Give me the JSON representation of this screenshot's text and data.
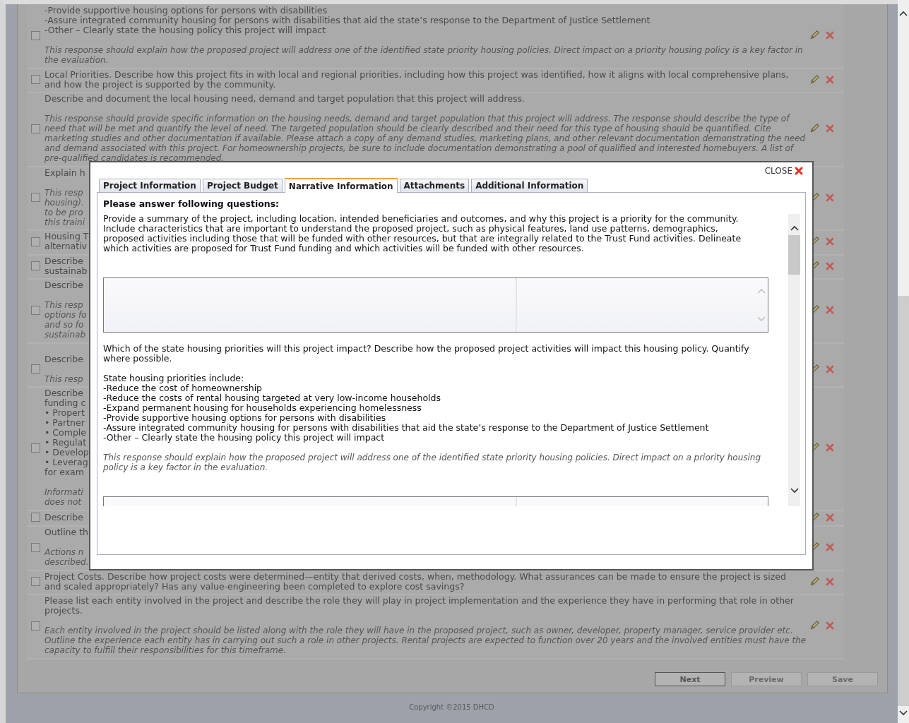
{
  "questions": [
    {
      "checked": false,
      "paragraphs": [
        {
          "kind": "text",
          "lines": [
            "-Provide supportive housing options for persons with disabilities",
            "-Assure integrated community housing for persons with disabilities that aid the state’s response to the Department of Justice Settlement",
            "-Other – Clearly state the housing policy this project will impact"
          ]
        },
        {
          "kind": "note",
          "lines": [
            "This response should explain how the proposed project will address one of the identified state priority housing policies. Direct impact on a priority housing policy is a key factor in",
            "the evaluation."
          ]
        }
      ]
    },
    {
      "checked": false,
      "paragraphs": [
        {
          "kind": "text",
          "lines": [
            "Local Priorities.  Describe how this project fits in with local and regional priorities, including how this project was identified, how it aligns with local comprehensive plans,",
            "and how the project is supported by the community."
          ]
        }
      ]
    },
    {
      "checked": false,
      "paragraphs": [
        {
          "kind": "text",
          "lines": [
            "Describe and document the local housing need, demand and target population that this project will address."
          ]
        },
        {
          "kind": "note",
          "lines": [
            "This response should provide specific information on the housing needs, demand and target population that this project will address. The response should describe the type of",
            "need that will be met and quantify the level of need. The targeted population should be clearly described and their need for this type of housing should be quantified. Cite",
            "marketing studies and other documentation if available. Please attach a copy of any demand studies, marketing plans, and other relevant documentation demonstrating the need",
            "and demand associated with this project. For homeownership projects, be sure to include documentation demonstrating a pool of qualified and interested homebuyers. A list of",
            "pre-qualified candidates is recommended."
          ]
        }
      ]
    },
    {
      "checked": false,
      "paragraphs": [
        {
          "kind": "text",
          "lines": [
            "Explain h"
          ]
        },
        {
          "kind": "note",
          "lines": [
            "This resp",
            "housing).",
            "to be pro",
            "this traini"
          ]
        }
      ]
    },
    {
      "checked": false,
      "paragraphs": [
        {
          "kind": "text",
          "lines": [
            "Housing T",
            "alternativ"
          ]
        }
      ]
    },
    {
      "checked": false,
      "paragraphs": [
        {
          "kind": "text",
          "lines": [
            "Describe",
            "sustainab"
          ]
        }
      ]
    },
    {
      "checked": false,
      "paragraphs": [
        {
          "kind": "text",
          "lines": [
            "Describe"
          ]
        },
        {
          "kind": "note",
          "lines": [
            "This resp",
            "options fo",
            "and so fo",
            "sustainab"
          ]
        }
      ]
    },
    {
      "checked": false,
      "blank_line_above": true,
      "paragraphs": [
        {
          "kind": "text",
          "lines": [
            "Describe"
          ]
        },
        {
          "kind": "note",
          "lines": [
            "This resp"
          ]
        }
      ]
    },
    {
      "checked": false,
      "paragraphs": [
        {
          "kind": "text",
          "lines": [
            "Describe",
            "funding c",
            "• Propert",
            "• Partner",
            "• Comple",
            "• Regulat",
            "• Develop",
            "• Leverag",
            "for exam"
          ]
        },
        {
          "kind": "note",
          "lines": [
            "Informati",
            "does not"
          ]
        }
      ]
    },
    {
      "checked": false,
      "paragraphs": [
        {
          "kind": "text",
          "lines": [
            "Describe"
          ]
        }
      ]
    },
    {
      "checked": false,
      "paragraphs": [
        {
          "kind": "text",
          "lines": [
            "Outline th"
          ]
        },
        {
          "kind": "note",
          "lines": [
            "Actions n",
            "described."
          ]
        }
      ]
    },
    {
      "checked": false,
      "paragraphs": [
        {
          "kind": "text",
          "lines": [
            "Project Costs.  Describe how project costs were determined—entity that derived costs, when, methodology.  What assurances can be made to ensure the project is sized",
            "and scaled appropriately?  Has any value-engineering been completed to explore cost savings?"
          ]
        }
      ]
    },
    {
      "checked": false,
      "paragraphs": [
        {
          "kind": "text",
          "lines": [
            "Please list each entity involved in the project and describe the role they will play in project implementation and the experience they have in performing that role in other",
            "projects."
          ]
        },
        {
          "kind": "note",
          "lines": [
            "Each entity involved in the project should be listed along with the role they will have in the proposed project, such as owner, developer, property manager, service provider etc.",
            "Outline the experience each entity has in carrying out such a role in other projects. Rental projects are expected to function over 20 years and the involved entities must have the",
            "capacity to fulfill their responsibilities for this timeframe."
          ]
        }
      ]
    }
  ],
  "buttons": [
    {
      "label": "Next",
      "kind": "primary"
    },
    {
      "label": "Preview",
      "kind": "secondary"
    },
    {
      "label": "Save",
      "kind": "secondary"
    }
  ],
  "footer": "Copyright ©2015 DHCD",
  "modal": {
    "close_label": "CLOSE",
    "tabs": [
      {
        "label": "Project Information",
        "selected": false
      },
      {
        "label": "Project Budget",
        "selected": false
      },
      {
        "label": "Narrative Information",
        "selected": true
      },
      {
        "label": "Attachments",
        "selected": false
      },
      {
        "label": "Additional Information",
        "selected": false
      }
    ],
    "heading": "Please answer following questions:",
    "questions": [
      {
        "paragraphs": [
          {
            "kind": "text",
            "lines": [
              "Provide a summary of the project, including location, intended beneficiaries and outcomes, and why this project is a priority for the community.",
              "Include characteristics that are important to understand the proposed project, such as physical features, land use patterns, demographics,",
              "proposed activities including those that will be funded with other resources, but that are integrally related to the Trust Fund activities. Delineate",
              "which activities are proposed for Trust Fund funding and which activities will be funded with other resources."
            ]
          }
        ]
      },
      {
        "paragraphs": [
          {
            "kind": "text",
            "lines": [
              "Which of the state housing priorities will this project impact? Describe how the proposed project activities will impact this housing policy. Quantify",
              "where possible."
            ]
          },
          {
            "kind": "text",
            "lines": [
              "State housing priorities include:",
              "-Reduce the cost of homeownership",
              "-Reduce the costs of rental housing targeted at very low-income households",
              "-Expand permanent housing for households experiencing homelessness",
              "-Provide supportive housing options for persons with disabilities",
              "-Assure integrated community housing for persons with disabilities that aid the state’s response to the Department of Justice Settlement",
              "-Other – Clearly state the housing policy this project will impact"
            ]
          },
          {
            "kind": "note",
            "lines": [
              "This response should explain how the proposed project will address one of the identified state priority housing policies. Direct impact on a priority housing",
              "policy is a key factor in the evaluation."
            ]
          }
        ]
      }
    ]
  }
}
